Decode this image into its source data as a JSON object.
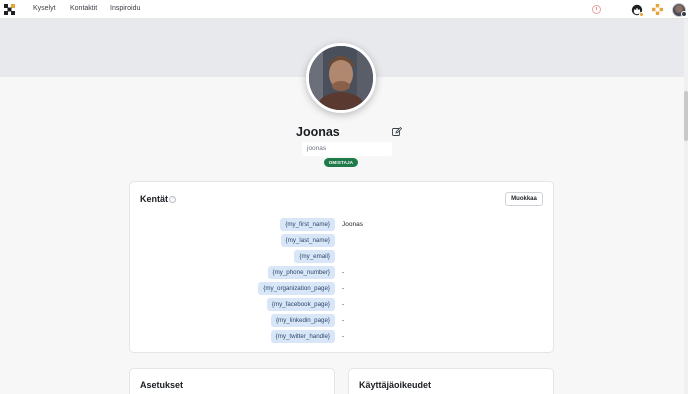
{
  "nav": {
    "links": [
      "Kyselyt",
      "Kontaktit",
      "Inspiroidu"
    ]
  },
  "profile": {
    "name": "Joonas",
    "username": "joonas",
    "role": "OMISTAJA"
  },
  "fields_card": {
    "title": "Kentät",
    "edit_label": "Muokkaa",
    "rows": [
      {
        "tag": "{my_first_name}",
        "value": "Joonas"
      },
      {
        "tag": "{my_last_name}",
        "value": ""
      },
      {
        "tag": "{my_email}",
        "value": ""
      },
      {
        "tag": "{my_phone_number}",
        "value": "-"
      },
      {
        "tag": "{my_organization_page}",
        "value": "-"
      },
      {
        "tag": "{my_facebook_page}",
        "value": "-"
      },
      {
        "tag": "{my_linkedin_page}",
        "value": "-"
      },
      {
        "tag": "{my_twitter_handle}",
        "value": "-"
      }
    ]
  },
  "settings_card": {
    "title": "Asetukset"
  },
  "permissions_card": {
    "title": "Käyttäjäoikeudet"
  },
  "colors": {
    "role_badge": "#1f7a4a",
    "field_tag_bg": "#d8e6f7",
    "banner": "#e7e9ed",
    "brand_orange": "#e7a23a"
  },
  "icons": {
    "logo": "brand-logo-icon",
    "history": "clock-icon",
    "mascot": "mascot-icon",
    "apps": "apps-grid-icon",
    "edit": "edit-pencil-icon",
    "help": "help-circle-icon"
  }
}
